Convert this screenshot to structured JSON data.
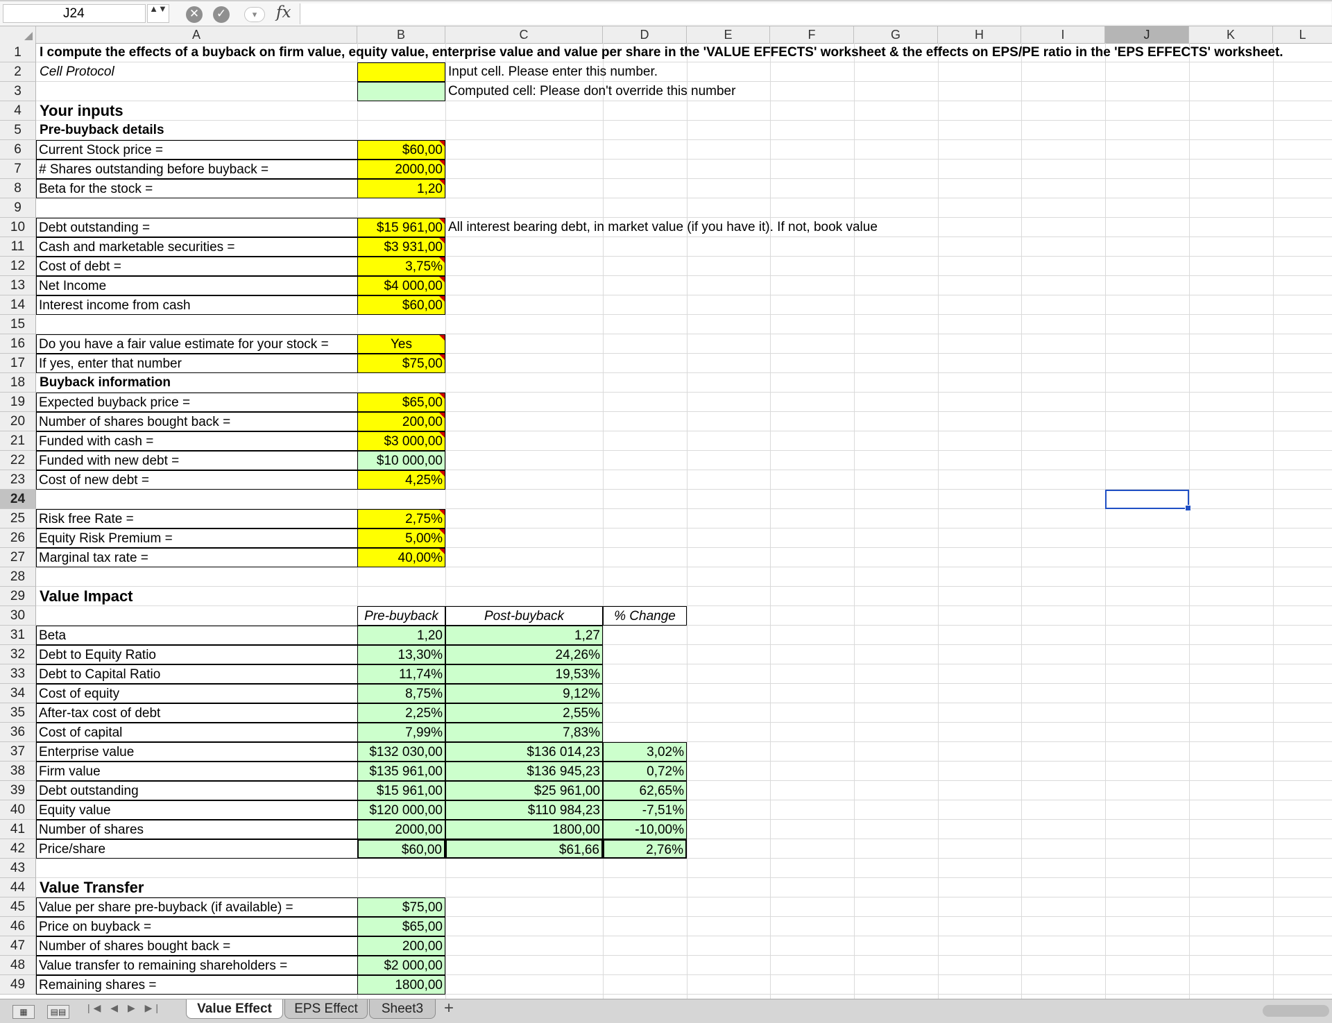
{
  "formula_bar": {
    "name_box": "J24",
    "stepper_glyph": "▲▼",
    "cancel_glyph": "✕",
    "confirm_glyph": "✓",
    "fx": "fx",
    "formula": ""
  },
  "columns": [
    "A",
    "B",
    "C",
    "D",
    "E",
    "F",
    "G",
    "H",
    "I",
    "J",
    "K",
    "L"
  ],
  "active_column": "J",
  "active_row": "24",
  "rows": [
    "1",
    "2",
    "3",
    "4",
    "5",
    "6",
    "7",
    "8",
    "9",
    "10",
    "11",
    "12",
    "13",
    "14",
    "15",
    "16",
    "17",
    "18",
    "19",
    "20",
    "21",
    "22",
    "23",
    "24",
    "25",
    "26",
    "27",
    "28",
    "29",
    "30",
    "31",
    "32",
    "33",
    "34",
    "35",
    "36",
    "37",
    "38",
    "39",
    "40",
    "41",
    "42",
    "43",
    "44",
    "45",
    "46",
    "47",
    "48",
    "49"
  ],
  "header": {
    "title": "I compute the effects of a buyback on firm value, equity value, enterprise value and value per share in the 'VALUE EFFECTS' worksheet & the effects on EPS/PE ratio in the 'EPS EFFECTS' worksheet.",
    "cell_protocol": "Cell Protocol",
    "input_note": "Input cell. Please enter this number.",
    "computed_note": "Computed cell: Please don't override this number"
  },
  "inputs": {
    "section_title": "Your inputs",
    "pre_buyback_title": "Pre-buyback details",
    "current_price_label": "Current Stock price =",
    "current_price": "$60,00",
    "shares_label": "# Shares outstanding before buyback =",
    "shares": "2000,00",
    "beta_label": "Beta for the stock =",
    "beta": "1,20",
    "debt_label": "Debt outstanding =",
    "debt": "$15 961,00",
    "debt_note": "All interest bearing debt, in market value (if you have it). If not, book value",
    "cash_label": "Cash and marketable securities =",
    "cash": "$3 931,00",
    "cost_debt_label": "Cost of debt =",
    "cost_debt": "3,75%",
    "net_income_label": "Net Income",
    "net_income": "$4 000,00",
    "interest_income_label": "Interest income from cash",
    "interest_income": "$60,00",
    "fair_value_q_label": "Do you have a fair value estimate for your stock =",
    "fair_value_q": "Yes",
    "fair_value_label": "If yes, enter that number",
    "fair_value": "$75,00",
    "buyback_title": "Buyback information",
    "buyback_price_label": "Expected buyback price =",
    "buyback_price": "$65,00",
    "shares_bought_label": "Number of shares bought back =",
    "shares_bought": "200,00",
    "funded_cash_label": "Funded with cash =",
    "funded_cash": "$3 000,00",
    "funded_debt_label": "Funded with new debt =",
    "funded_debt": "$10 000,00",
    "cost_new_debt_label": "Cost of new debt =",
    "cost_new_debt": "4,25%",
    "rf_label": "Risk free Rate =",
    "rf": "2,75%",
    "erp_label": "Equity Risk Premium =",
    "erp": "5,00%",
    "tax_label": "Marginal tax rate =",
    "tax": "40,00%"
  },
  "value_impact": {
    "title": "Value Impact",
    "headers": [
      "Pre-buyback",
      "Post-buyback",
      "% Change"
    ],
    "rows": [
      {
        "label": "Beta",
        "pre": "1,20",
        "post": "1,27",
        "chg": ""
      },
      {
        "label": "Debt to Equity Ratio",
        "pre": "13,30%",
        "post": "24,26%",
        "chg": ""
      },
      {
        "label": "Debt to Capital Ratio",
        "pre": "11,74%",
        "post": "19,53%",
        "chg": ""
      },
      {
        "label": "Cost of equity",
        "pre": "8,75%",
        "post": "9,12%",
        "chg": ""
      },
      {
        "label": "After-tax cost of debt",
        "pre": "2,25%",
        "post": "2,55%",
        "chg": ""
      },
      {
        "label": "Cost of capital",
        "pre": "7,99%",
        "post": "7,83%",
        "chg": ""
      },
      {
        "label": "Enterprise value",
        "pre": "$132 030,00",
        "post": "$136 014,23",
        "chg": "3,02%"
      },
      {
        "label": "Firm value",
        "pre": "$135 961,00",
        "post": "$136 945,23",
        "chg": "0,72%"
      },
      {
        "label": "Debt outstanding",
        "pre": "$15 961,00",
        "post": "$25 961,00",
        "chg": "62,65%"
      },
      {
        "label": "Equity value",
        "pre": "$120 000,00",
        "post": "$110 984,23",
        "chg": "-7,51%"
      },
      {
        "label": "Number of shares",
        "pre": "2000,00",
        "post": "1800,00",
        "chg": "-10,00%"
      },
      {
        "label": "Price/share",
        "pre": "$60,00",
        "post": "$61,66",
        "chg": "2,76%"
      }
    ]
  },
  "value_transfer": {
    "title": "Value Transfer",
    "rows": [
      {
        "label": "Value per share pre-buyback (if available) =",
        "value": "$75,00"
      },
      {
        "label": "Price on buyback =",
        "value": "$65,00"
      },
      {
        "label": "Number of shares bought back =",
        "value": "200,00"
      },
      {
        "label": "Value transfer to remaining shareholders =",
        "value": "$2 000,00"
      },
      {
        "label": "Remaining shares =",
        "value": "1800,00"
      }
    ]
  },
  "tabs": {
    "nav_arrows": "|◀ ◀ ▶ ▶|",
    "sheets": [
      "Value Effect",
      "EPS Effect",
      "Sheet3"
    ],
    "add": "+",
    "normal_view": "▦",
    "page_layout_view": "▤▤"
  },
  "colors": {
    "input": "#ffff00",
    "computed": "#ccffcc",
    "selection": "#1f4fc4"
  }
}
